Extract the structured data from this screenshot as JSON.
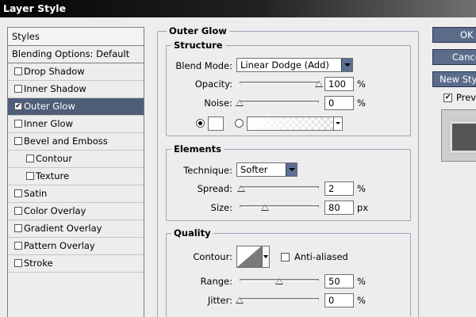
{
  "window": {
    "title": "Layer Style"
  },
  "styles_panel": {
    "header": "Styles",
    "blending_options": "Blending Options: Default",
    "items": [
      {
        "label": "Drop Shadow",
        "checked": false,
        "indent": false,
        "selected": false
      },
      {
        "label": "Inner Shadow",
        "checked": false,
        "indent": false,
        "selected": false
      },
      {
        "label": "Outer Glow",
        "checked": true,
        "indent": false,
        "selected": true
      },
      {
        "label": "Inner Glow",
        "checked": false,
        "indent": false,
        "selected": false
      },
      {
        "label": "Bevel and Emboss",
        "checked": false,
        "indent": false,
        "selected": false
      },
      {
        "label": "Contour",
        "checked": false,
        "indent": true,
        "selected": false
      },
      {
        "label": "Texture",
        "checked": false,
        "indent": true,
        "selected": false
      },
      {
        "label": "Satin",
        "checked": false,
        "indent": false,
        "selected": false
      },
      {
        "label": "Color Overlay",
        "checked": false,
        "indent": false,
        "selected": false
      },
      {
        "label": "Gradient Overlay",
        "checked": false,
        "indent": false,
        "selected": false
      },
      {
        "label": "Pattern Overlay",
        "checked": false,
        "indent": false,
        "selected": false
      },
      {
        "label": "Stroke",
        "checked": false,
        "indent": false,
        "selected": false
      }
    ]
  },
  "outer_glow": {
    "title": "Outer Glow",
    "structure": {
      "title": "Structure",
      "blend_mode_label": "Blend Mode:",
      "blend_mode_value": "Linear Dodge (Add)",
      "opacity_label": "Opacity:",
      "opacity_value": "100",
      "opacity_fraction": 1.0,
      "opacity_unit": "%",
      "noise_label": "Noise:",
      "noise_value": "0",
      "noise_fraction": 0.0,
      "noise_unit": "%",
      "color_mode": "solid",
      "glow_color": "#ffffff"
    },
    "elements": {
      "title": "Elements",
      "technique_label": "Technique:",
      "technique_value": "Softer",
      "spread_label": "Spread:",
      "spread_value": "2",
      "spread_fraction": 0.02,
      "spread_unit": "%",
      "size_label": "Size:",
      "size_value": "80",
      "size_fraction": 0.32,
      "size_unit": "px"
    },
    "quality": {
      "title": "Quality",
      "contour_label": "Contour:",
      "anti_aliased_label": "Anti-aliased",
      "anti_aliased": false,
      "range_label": "Range:",
      "range_value": "50",
      "range_fraction": 0.5,
      "range_unit": "%",
      "jitter_label": "Jitter:",
      "jitter_value": "0",
      "jitter_fraction": 0.0,
      "jitter_unit": "%"
    }
  },
  "buttons": {
    "ok": "OK",
    "cancel": "Cancel",
    "new_style": "New Style...",
    "preview": "Preview",
    "preview_checked": true
  },
  "colors": {
    "selection": "#4e5e78",
    "button": "#5b6c8b",
    "group_border": "#97a7bb"
  }
}
